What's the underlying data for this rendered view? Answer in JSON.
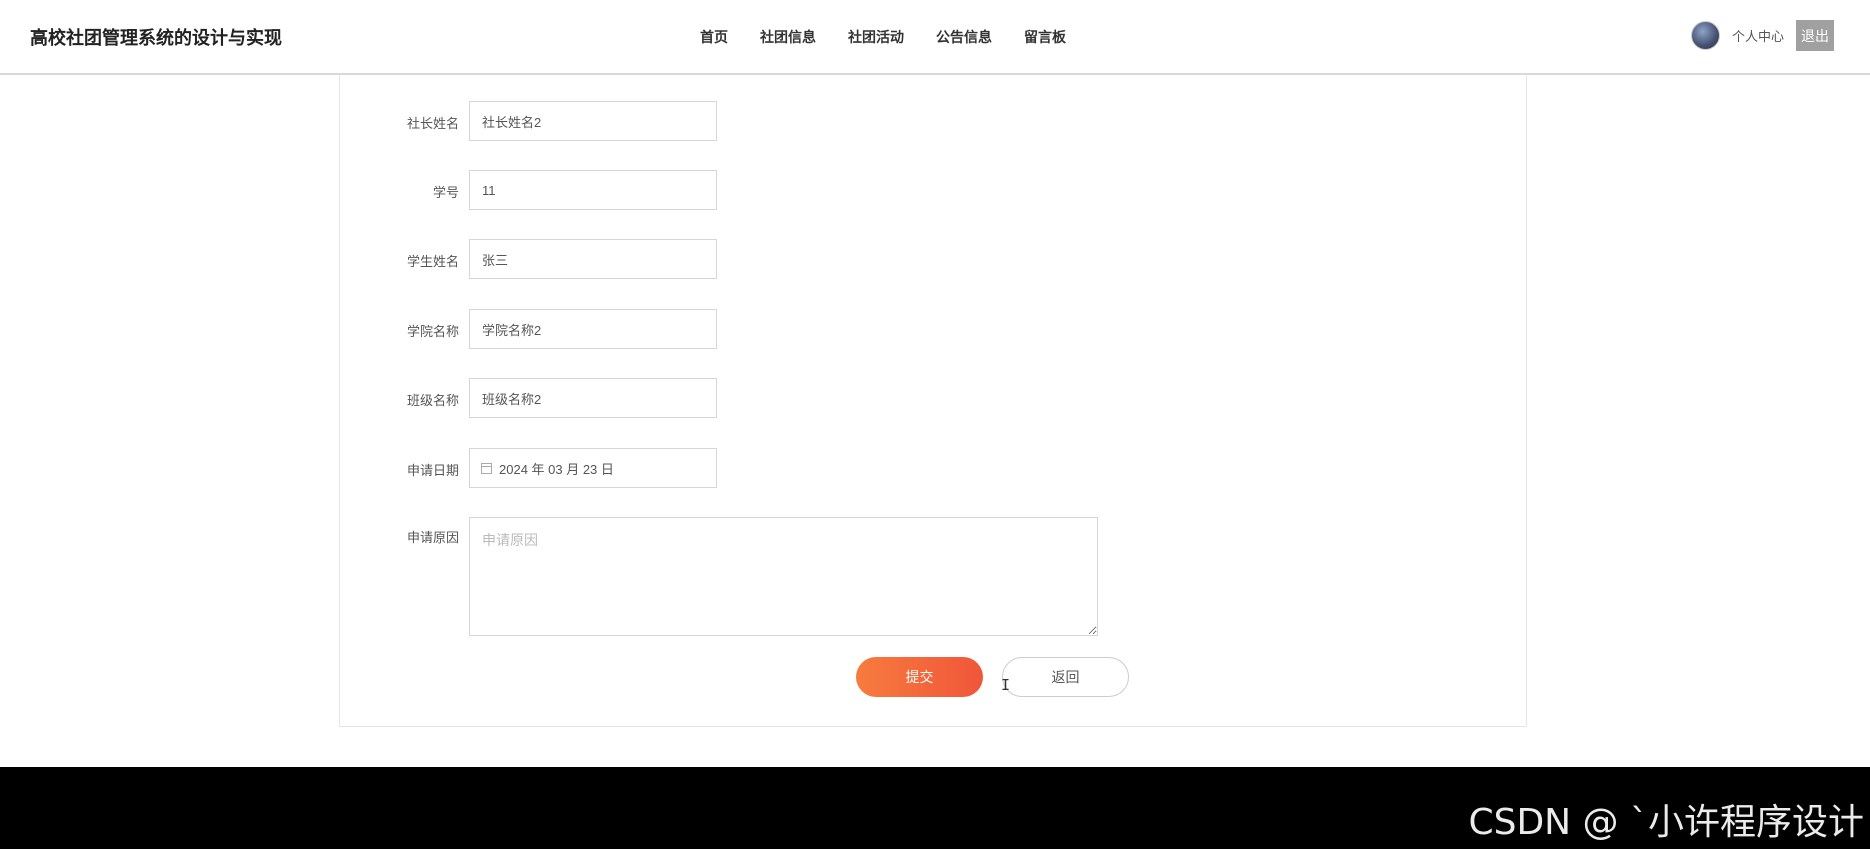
{
  "header": {
    "site_title": "高校社团管理系统的设计与实现",
    "nav": [
      "首页",
      "社团信息",
      "社团活动",
      "公告信息",
      "留言板"
    ],
    "user_center": "个人中心",
    "logout": "退出"
  },
  "form": {
    "fields": [
      {
        "label": "社长姓名",
        "value": "社长姓名2"
      },
      {
        "label": "学号",
        "value": "11"
      },
      {
        "label": "学生姓名",
        "value": "张三"
      },
      {
        "label": "学院名称",
        "value": "学院名称2"
      },
      {
        "label": "班级名称",
        "value": "班级名称2"
      }
    ],
    "date": {
      "label": "申请日期",
      "value": "2024 年 03 月 23 日"
    },
    "reason": {
      "label": "申请原因",
      "placeholder": "申请原因",
      "value": ""
    },
    "submit_label": "提交",
    "back_label": "返回"
  },
  "watermark": "CSDN @ ˋ小许程序设计"
}
